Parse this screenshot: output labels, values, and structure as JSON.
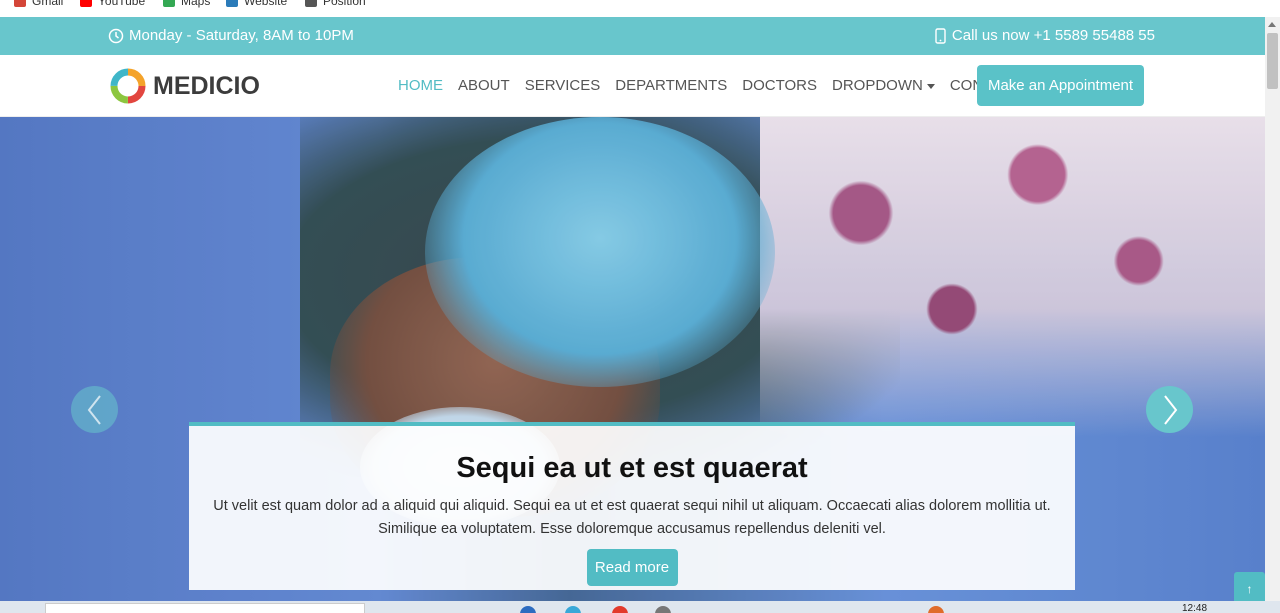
{
  "bookmarks": [
    {
      "label": "Gmail",
      "icon": "gmail-icon",
      "color": "#d44638"
    },
    {
      "label": "YouTube",
      "icon": "youtube-icon",
      "color": "#ff0000"
    },
    {
      "label": "Maps",
      "icon": "maps-icon",
      "color": "#34a853"
    },
    {
      "label": "Website",
      "icon": "website-icon",
      "color": "#2b7bb9"
    },
    {
      "label": "Position",
      "icon": "position-icon",
      "color": "#555555"
    }
  ],
  "topbar": {
    "hours": "Monday - Saturday, 8AM to 10PM",
    "call": "Call us now +1 5589 55488 55",
    "color": "#68c6cc"
  },
  "header": {
    "logo_text": "MEDICIO",
    "nav": [
      {
        "label": "HOME",
        "active": true
      },
      {
        "label": "ABOUT",
        "active": false
      },
      {
        "label": "SERVICES",
        "active": false
      },
      {
        "label": "DEPARTMENTS",
        "active": false
      },
      {
        "label": "DOCTORS",
        "active": false
      },
      {
        "label": "DROPDOWN",
        "active": false,
        "dropdown": true
      },
      {
        "label": "CONTACT",
        "active": false
      }
    ],
    "appointment_button": "Make an Appointment",
    "accent": "#52bcc4"
  },
  "hero": {
    "title": "Sequi ea ut et est quaerat",
    "text": "Ut velit est quam dolor ad a aliquid qui aliquid. Sequi ea ut et est quaerat sequi nihil ut aliquam. Occaecati alias dolorem mollitia ut. Similique ea voluptatem. Esse doloremque accusamus repellendus deleniti vel.",
    "button": "Read more",
    "prev_icon": "chevron-left-icon",
    "next_icon": "chevron-right-icon"
  },
  "back_to_top": "↑",
  "taskbar": {
    "clock": "12:48"
  }
}
